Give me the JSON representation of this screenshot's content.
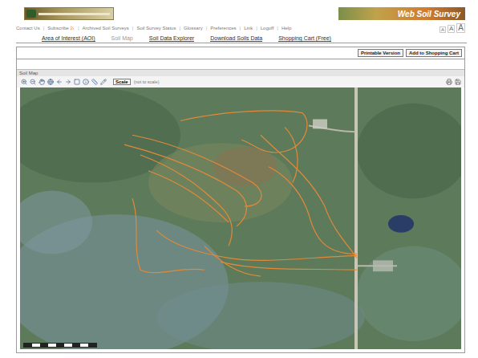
{
  "header": {
    "banner": "Web Soil Survey"
  },
  "nav_links": [
    "Contact Us",
    "Subscribe",
    "Archived Soil Surveys",
    "Soil Survey Status",
    "Glossary",
    "Preferences",
    "Link",
    "Logoff",
    "Help"
  ],
  "text_size": [
    "A",
    "A",
    "A"
  ],
  "tabs": [
    {
      "label": "Area of Interest (AOI)",
      "selected": false
    },
    {
      "label": "Soil Map",
      "selected": true
    },
    {
      "label": "Soil Data Explorer",
      "selected": false
    },
    {
      "label": "Download Soils Data",
      "selected": false
    },
    {
      "label": "Shopping Cart (Free)",
      "selected": false
    }
  ],
  "actions": [
    "Printable Version",
    "Add to Shopping Cart"
  ],
  "panel": {
    "title": "Soil Map"
  },
  "toolbar": {
    "scale_button": "Scale",
    "scale_note": "(not to scale)"
  }
}
